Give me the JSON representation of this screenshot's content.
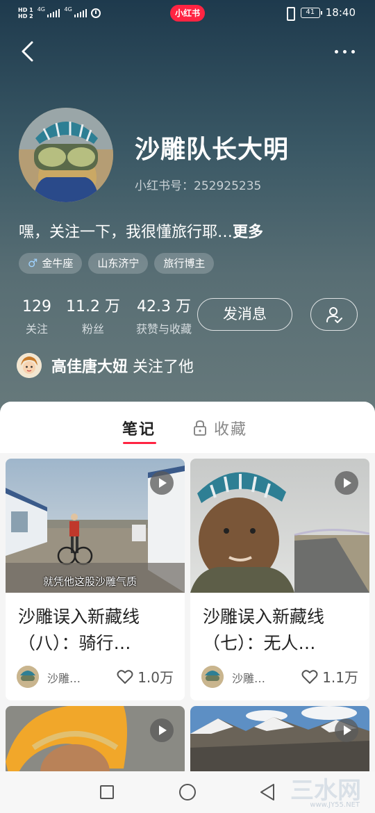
{
  "status_bar": {
    "sim1": "HD 1",
    "sim2": "HD 2",
    "net1": "4G",
    "net2": "4G",
    "app_badge": "小红书",
    "battery": "41",
    "time": "18:40"
  },
  "profile": {
    "name": "沙雕队长大明",
    "id_label": "小红书号：",
    "id_value": "252925235",
    "bio": "嘿，关注一下，我很懂旅行耶…",
    "bio_more": "更多",
    "tags": [
      {
        "icon": "male-icon",
        "label": "金牛座"
      },
      {
        "label": "山东济宁"
      },
      {
        "label": "旅行博主"
      }
    ],
    "stats": [
      {
        "num": "129",
        "label": "关注"
      },
      {
        "num": "11.2 万",
        "label": "粉丝"
      },
      {
        "num": "42.3 万",
        "label": "获赞与收藏"
      }
    ],
    "message_button": "发消息",
    "follower_name": "高佳唐大妞",
    "follower_text": "关注了他"
  },
  "tabs": {
    "notes": "笔记",
    "collect": "收藏"
  },
  "notes": [
    {
      "caption": "就凭他这股沙雕气质",
      "title": "沙雕误入新藏线（八）：骑行…",
      "author": "沙雕…",
      "likes": "1.0万"
    },
    {
      "caption": "",
      "title": "沙雕误入新藏线（七）：无人…",
      "author": "沙雕…",
      "likes": "1.1万"
    }
  ],
  "watermark": {
    "main": "三水网",
    "sub": "www.JY55.NET"
  },
  "colors": {
    "accent": "#ff2442",
    "header_top": "#1e3a4d",
    "header_bottom": "#687a7c"
  }
}
